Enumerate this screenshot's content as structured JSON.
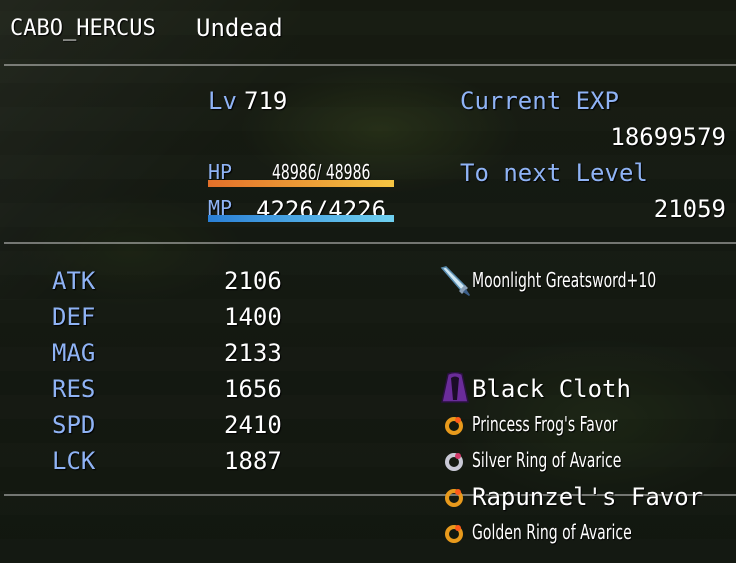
{
  "actor": {
    "name": "CABO_HERCUS",
    "class": "Undead"
  },
  "level": {
    "label": "Lv",
    "value": "719"
  },
  "hp": {
    "label": "HP",
    "value": "48986/ 48986",
    "ratio": 1.0,
    "color_from": "#e3702a",
    "color_to": "#f5c542"
  },
  "mp": {
    "label": "MP",
    "value": "4226/4226",
    "ratio": 1.0,
    "color_from": "#2a7fd6",
    "color_to": "#6fd0f0"
  },
  "exp": {
    "current_label": "Current EXP",
    "current_value": "18699579",
    "next_label": "To next Level",
    "next_value": "21059"
  },
  "params": [
    {
      "label": "ATK",
      "value": "2106"
    },
    {
      "label": "DEF",
      "value": "1400"
    },
    {
      "label": "MAG",
      "value": "2133"
    },
    {
      "label": "RES",
      "value": "1656"
    },
    {
      "label": "SPD",
      "value": "2410"
    },
    {
      "label": "LCK",
      "value": "1887"
    }
  ],
  "equips": [
    {
      "name": "Moonlight Greatsword+10",
      "icon": "sword-icon"
    },
    {
      "name": "Black Cloth",
      "icon": "cloak-icon"
    },
    {
      "name": "Princess Frog's Favor",
      "icon": "gold-ring-icon"
    },
    {
      "name": "Silver Ring of Avarice",
      "icon": "silver-ring-icon"
    },
    {
      "name": "Rapunzel's Favor",
      "icon": "gold-ring-icon"
    },
    {
      "name": "Golden Ring of Avarice",
      "icon": "gold-ring-icon"
    }
  ],
  "colors": {
    "system": "#8fb3f5",
    "text": "#ffffff"
  }
}
